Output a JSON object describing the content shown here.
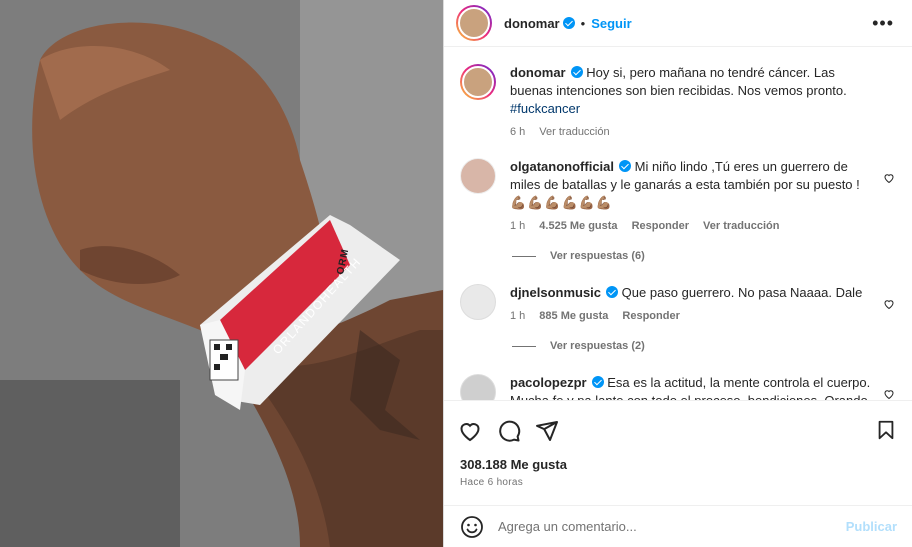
{
  "post": {
    "author": "donomar",
    "follow_label": "Seguir",
    "dot": "•",
    "more": "•••",
    "caption": "Hoy si, pero mañana no tendré cáncer. Las buenas intenciones son bien recibidas. Nos vemos pronto.",
    "hashtag": "#fuckcancer",
    "caption_time": "6 h",
    "translate": "Ver traducción",
    "likes": "308.188 Me gusta",
    "posted": "Hace 6 horas"
  },
  "wristband": {
    "brand": "ORLANDOHEALTH",
    "code": "ORM"
  },
  "comments": [
    {
      "user": "olgatanonofficial",
      "text": "Mi niño lindo ,Tú eres un guerrero de miles de batallas y le ganarás a esta también por su puesto !",
      "emoji": "💪🏽💪🏽💪🏽💪🏽💪🏽💪🏽",
      "time": "1 h",
      "likes": "4.525 Me gusta",
      "reply": "Responder",
      "translate": "Ver traducción",
      "replies": "Ver respuestas (6)"
    },
    {
      "user": "djnelsonmusic",
      "text": "Que paso guerrero. No pasa Naaaa. Dale",
      "time": "1 h",
      "likes": "885 Me gusta",
      "reply": "Responder",
      "replies": "Ver respuestas (2)"
    },
    {
      "user": "pacolopezpr",
      "text": "Esa es la actitud, la mente controla el cuerpo. Mucha fe y pa lante con todo el proceso, bendiciones. Orando"
    }
  ],
  "add_comment": {
    "placeholder": "Agrega un comentario...",
    "publish": "Publicar"
  },
  "colors": {
    "accent": "#0095f6",
    "band_red": "#d7283c",
    "hashtag": "#00376b"
  },
  "icons": [
    "heart-icon",
    "comment-icon",
    "share-icon",
    "bookmark-icon",
    "emoji-icon",
    "verified-icon"
  ]
}
